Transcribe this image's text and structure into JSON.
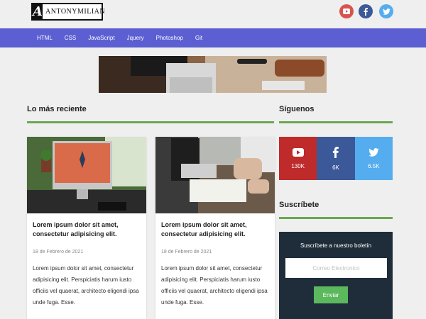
{
  "header": {
    "logo_letter": "A",
    "logo_text": "ANTONYMILIAN",
    "social_icons": [
      "youtube-icon",
      "facebook-icon",
      "twitter-icon"
    ]
  },
  "nav": {
    "items": [
      {
        "label": "HTML"
      },
      {
        "label": "CSS"
      },
      {
        "label": "JavaScript"
      },
      {
        "label": "Jquery"
      },
      {
        "label": "Photoshop"
      },
      {
        "label": "Git"
      }
    ]
  },
  "sections": {
    "recent_title": "Lo más reciente",
    "follow_title": "Síguenos",
    "subscribe_title": "Suscríbete"
  },
  "posts": [
    {
      "title": "Lorem ipsum dolor sit amet, consectetur adipisicing elit.",
      "date": "18 de Febrero de 2021",
      "excerpt": "Lorem ipsum dolor sit amet, consectetur adipisicing elit. Perspiciatis harum iusto officiis vel quaerat, architecto eligendi ipsa unde fuga. Esse."
    },
    {
      "title": "Lorem ipsum dolor sit amet, consectetur adipisicing elit.",
      "date": "18 de Febrero de 2021",
      "excerpt": "Lorem ipsum dolor sit amet, consectetur adipisicing elit. Perspiciatis harum iusto officiis vel quaerat, architecto eligendi ipsa unde fuga. Esse."
    }
  ],
  "follow": {
    "youtube_count": "130K",
    "facebook_count": "6K",
    "twitter_count": "6.5K"
  },
  "subscribe": {
    "heading": "Suscríbete a nuestro boletín",
    "placeholder": "Correo Electronico",
    "button_label": "Enviar"
  },
  "colors": {
    "nav": "#5b5fd1",
    "accent_rule": "#6aa84f",
    "youtube": "#bf2a2a",
    "facebook": "#3b5998",
    "twitter": "#55acee",
    "subscribe_bg": "#1f2d3a",
    "button": "#5cb85c"
  }
}
